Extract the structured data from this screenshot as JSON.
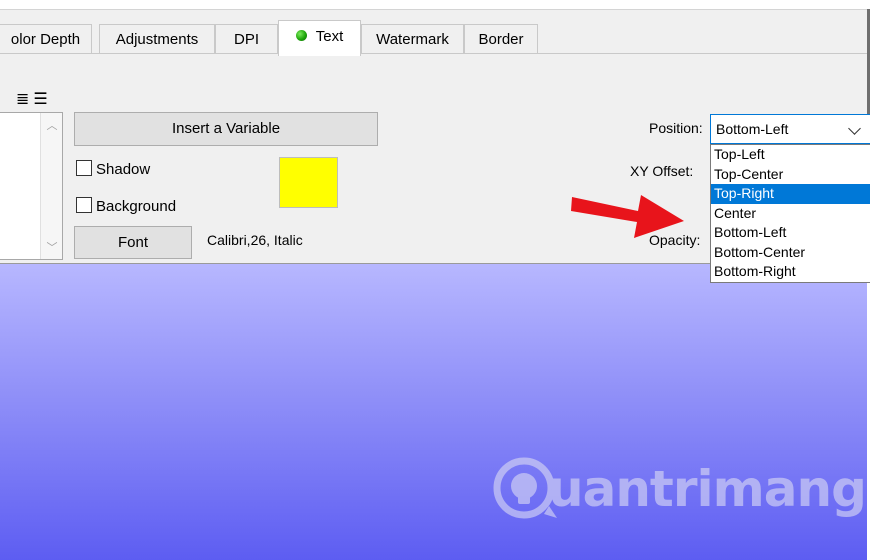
{
  "tabs": [
    {
      "label": "olor Depth",
      "active": false
    },
    {
      "label": "Adjustments",
      "active": false
    },
    {
      "label": "DPI",
      "active": false
    },
    {
      "label": "Text",
      "active": true
    },
    {
      "label": "Watermark",
      "active": false
    },
    {
      "label": "Border",
      "active": false
    }
  ],
  "panel": {
    "insert_variable_label": "Insert a Variable",
    "shadow_label": "Shadow",
    "shadow_checked": false,
    "background_label": "Background",
    "background_checked": false,
    "font_button_label": "Font",
    "font_info": "Calibri,26, Italic",
    "text_color": "#ffff00",
    "position_label": "Position:",
    "position_value": "Bottom-Left",
    "xy_offset_label": "XY Offset:",
    "opacity_label": "Opacity:",
    "position_options": [
      "Top-Left",
      "Top-Center",
      "Top-Right",
      "Center",
      "Bottom-Left",
      "Bottom-Center",
      "Bottom-Right"
    ],
    "highlighted_option": "Top-Right"
  },
  "watermark": {
    "logo_text": "uantrimang"
  },
  "colors": {
    "accent": "#0078d7",
    "arrow": "#e8141b",
    "preview_top": "#b7b7ff",
    "preview_bottom": "#5d5df2"
  },
  "icons": [
    "align-center-icon",
    "align-right-icon",
    "scroll-up-icon",
    "scroll-down-icon",
    "chevron-down-icon",
    "lightbulb-icon"
  ]
}
